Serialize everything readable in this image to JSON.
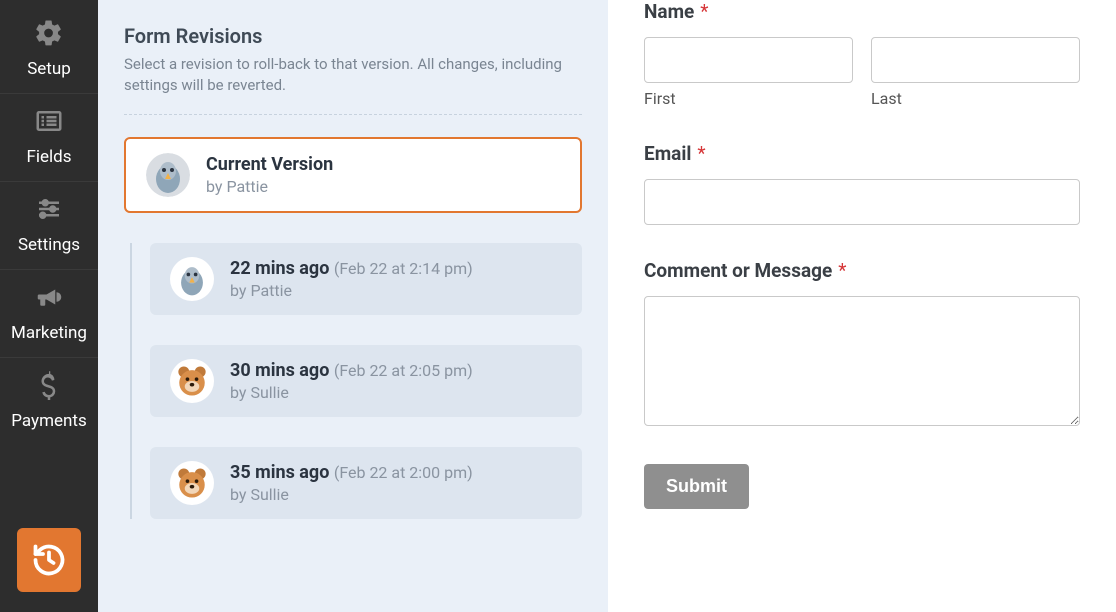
{
  "sidebar": {
    "items": [
      {
        "label": "Setup",
        "icon": "gear-icon"
      },
      {
        "label": "Fields",
        "icon": "list-icon"
      },
      {
        "label": "Settings",
        "icon": "sliders-icon"
      },
      {
        "label": "Marketing",
        "icon": "bullhorn-icon"
      },
      {
        "label": "Payments",
        "icon": "dollar-icon"
      }
    ],
    "history_button": {
      "icon": "history-icon",
      "active": true
    }
  },
  "revisions": {
    "title": "Form Revisions",
    "subtitle": "Select a revision to roll-back to that version. All changes, including settings will be reverted.",
    "current": {
      "title": "Current Version",
      "by_prefix": "by ",
      "author": "Pattie",
      "avatar": "pigeon"
    },
    "items": [
      {
        "ago": "22 mins ago",
        "timestamp": "(Feb 22 at 2:14 pm)",
        "by_prefix": "by ",
        "author": "Pattie",
        "avatar": "pigeon"
      },
      {
        "ago": "30 mins ago",
        "timestamp": "(Feb 22 at 2:05 pm)",
        "by_prefix": "by ",
        "author": "Sullie",
        "avatar": "bear"
      },
      {
        "ago": "35 mins ago",
        "timestamp": "(Feb 22 at 2:00 pm)",
        "by_prefix": "by ",
        "author": "Sullie",
        "avatar": "bear"
      }
    ]
  },
  "form": {
    "name_label": "Name",
    "first_label": "First",
    "last_label": "Last",
    "email_label": "Email",
    "comment_label": "Comment or Message",
    "required_marker": "*",
    "submit_label": "Submit"
  },
  "colors": {
    "accent": "#e27730",
    "sidebar_bg": "#2d2d2d",
    "panel_bg": "#eaf0f8"
  }
}
